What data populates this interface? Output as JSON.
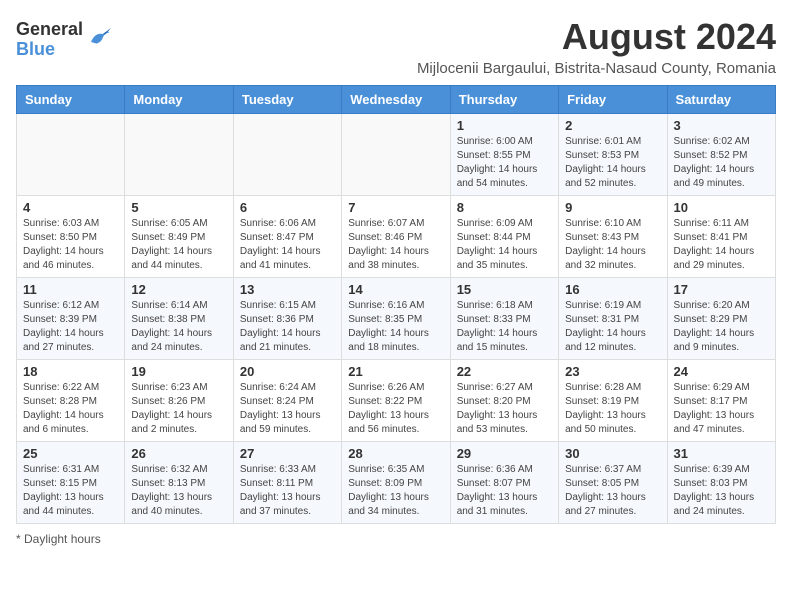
{
  "header": {
    "logo": {
      "line1": "General",
      "line2": "Blue"
    },
    "title": "August 2024",
    "subtitle": "Mijlocenii Bargaului, Bistrita-Nasaud County, Romania"
  },
  "columns": [
    "Sunday",
    "Monday",
    "Tuesday",
    "Wednesday",
    "Thursday",
    "Friday",
    "Saturday"
  ],
  "weeks": [
    [
      {
        "day": "",
        "info": ""
      },
      {
        "day": "",
        "info": ""
      },
      {
        "day": "",
        "info": ""
      },
      {
        "day": "",
        "info": ""
      },
      {
        "day": "1",
        "info": "Sunrise: 6:00 AM\nSunset: 8:55 PM\nDaylight: 14 hours\nand 54 minutes."
      },
      {
        "day": "2",
        "info": "Sunrise: 6:01 AM\nSunset: 8:53 PM\nDaylight: 14 hours\nand 52 minutes."
      },
      {
        "day": "3",
        "info": "Sunrise: 6:02 AM\nSunset: 8:52 PM\nDaylight: 14 hours\nand 49 minutes."
      }
    ],
    [
      {
        "day": "4",
        "info": "Sunrise: 6:03 AM\nSunset: 8:50 PM\nDaylight: 14 hours\nand 46 minutes."
      },
      {
        "day": "5",
        "info": "Sunrise: 6:05 AM\nSunset: 8:49 PM\nDaylight: 14 hours\nand 44 minutes."
      },
      {
        "day": "6",
        "info": "Sunrise: 6:06 AM\nSunset: 8:47 PM\nDaylight: 14 hours\nand 41 minutes."
      },
      {
        "day": "7",
        "info": "Sunrise: 6:07 AM\nSunset: 8:46 PM\nDaylight: 14 hours\nand 38 minutes."
      },
      {
        "day": "8",
        "info": "Sunrise: 6:09 AM\nSunset: 8:44 PM\nDaylight: 14 hours\nand 35 minutes."
      },
      {
        "day": "9",
        "info": "Sunrise: 6:10 AM\nSunset: 8:43 PM\nDaylight: 14 hours\nand 32 minutes."
      },
      {
        "day": "10",
        "info": "Sunrise: 6:11 AM\nSunset: 8:41 PM\nDaylight: 14 hours\nand 29 minutes."
      }
    ],
    [
      {
        "day": "11",
        "info": "Sunrise: 6:12 AM\nSunset: 8:39 PM\nDaylight: 14 hours\nand 27 minutes."
      },
      {
        "day": "12",
        "info": "Sunrise: 6:14 AM\nSunset: 8:38 PM\nDaylight: 14 hours\nand 24 minutes."
      },
      {
        "day": "13",
        "info": "Sunrise: 6:15 AM\nSunset: 8:36 PM\nDaylight: 14 hours\nand 21 minutes."
      },
      {
        "day": "14",
        "info": "Sunrise: 6:16 AM\nSunset: 8:35 PM\nDaylight: 14 hours\nand 18 minutes."
      },
      {
        "day": "15",
        "info": "Sunrise: 6:18 AM\nSunset: 8:33 PM\nDaylight: 14 hours\nand 15 minutes."
      },
      {
        "day": "16",
        "info": "Sunrise: 6:19 AM\nSunset: 8:31 PM\nDaylight: 14 hours\nand 12 minutes."
      },
      {
        "day": "17",
        "info": "Sunrise: 6:20 AM\nSunset: 8:29 PM\nDaylight: 14 hours\nand 9 minutes."
      }
    ],
    [
      {
        "day": "18",
        "info": "Sunrise: 6:22 AM\nSunset: 8:28 PM\nDaylight: 14 hours\nand 6 minutes."
      },
      {
        "day": "19",
        "info": "Sunrise: 6:23 AM\nSunset: 8:26 PM\nDaylight: 14 hours\nand 2 minutes."
      },
      {
        "day": "20",
        "info": "Sunrise: 6:24 AM\nSunset: 8:24 PM\nDaylight: 13 hours\nand 59 minutes."
      },
      {
        "day": "21",
        "info": "Sunrise: 6:26 AM\nSunset: 8:22 PM\nDaylight: 13 hours\nand 56 minutes."
      },
      {
        "day": "22",
        "info": "Sunrise: 6:27 AM\nSunset: 8:20 PM\nDaylight: 13 hours\nand 53 minutes."
      },
      {
        "day": "23",
        "info": "Sunrise: 6:28 AM\nSunset: 8:19 PM\nDaylight: 13 hours\nand 50 minutes."
      },
      {
        "day": "24",
        "info": "Sunrise: 6:29 AM\nSunset: 8:17 PM\nDaylight: 13 hours\nand 47 minutes."
      }
    ],
    [
      {
        "day": "25",
        "info": "Sunrise: 6:31 AM\nSunset: 8:15 PM\nDaylight: 13 hours\nand 44 minutes."
      },
      {
        "day": "26",
        "info": "Sunrise: 6:32 AM\nSunset: 8:13 PM\nDaylight: 13 hours\nand 40 minutes."
      },
      {
        "day": "27",
        "info": "Sunrise: 6:33 AM\nSunset: 8:11 PM\nDaylight: 13 hours\nand 37 minutes."
      },
      {
        "day": "28",
        "info": "Sunrise: 6:35 AM\nSunset: 8:09 PM\nDaylight: 13 hours\nand 34 minutes."
      },
      {
        "day": "29",
        "info": "Sunrise: 6:36 AM\nSunset: 8:07 PM\nDaylight: 13 hours\nand 31 minutes."
      },
      {
        "day": "30",
        "info": "Sunrise: 6:37 AM\nSunset: 8:05 PM\nDaylight: 13 hours\nand 27 minutes."
      },
      {
        "day": "31",
        "info": "Sunrise: 6:39 AM\nSunset: 8:03 PM\nDaylight: 13 hours\nand 24 minutes."
      }
    ]
  ],
  "footer": "Daylight hours"
}
